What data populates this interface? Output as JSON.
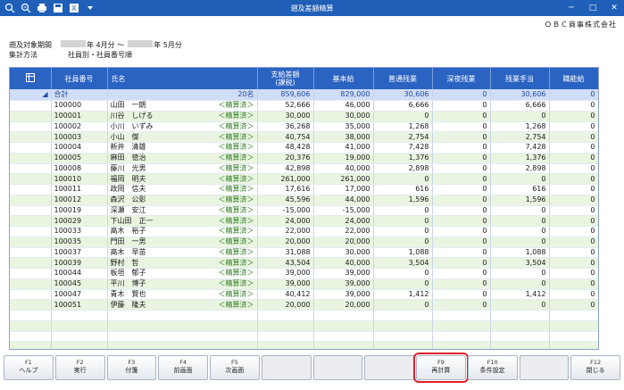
{
  "window": {
    "title": "遡及差額精算"
  },
  "toolbar_icons": [
    "add-icon",
    "search-icon",
    "print-icon",
    "save-icon",
    "excel-icon",
    "dropdown-icon"
  ],
  "company": "ＯＢＣ商事株式会社",
  "header": {
    "period_label": "遡及対象期間",
    "period_from": "年 4月分 ～",
    "period_to": "年 5月分",
    "method_label": "集計方法",
    "method_value": "社員別・社員番号順"
  },
  "columns": [
    "社員番号",
    "氏名",
    "支給差額\n(課税)",
    "基本給",
    "普通残業",
    "深夜残業",
    "残業手当",
    "職能給"
  ],
  "total": {
    "label": "合計",
    "count": "20名",
    "diff": "859,606",
    "base": "829,000",
    "ot": "30,606",
    "night": "0",
    "ot_allow": "30,606",
    "skill": "0"
  },
  "rows": [
    {
      "no": "100000",
      "name": "山田　一朗",
      "status": "＜精算済＞",
      "diff": "52,666",
      "base": "46,000",
      "ot": "6,666",
      "night": "0",
      "ot_allow": "6,666",
      "skill": "0"
    },
    {
      "no": "100001",
      "name": "川谷　しげる",
      "status": "＜精算済＞",
      "diff": "30,000",
      "base": "30,000",
      "ot": "0",
      "night": "0",
      "ot_allow": "0",
      "skill": "0"
    },
    {
      "no": "100002",
      "name": "小川　いずみ",
      "status": "＜精算済＞",
      "diff": "36,268",
      "base": "35,000",
      "ot": "1,268",
      "night": "0",
      "ot_allow": "1,268",
      "skill": "0"
    },
    {
      "no": "100003",
      "name": "小山　傑",
      "status": "＜精算済＞",
      "diff": "40,754",
      "base": "38,000",
      "ot": "2,754",
      "night": "0",
      "ot_allow": "2,754",
      "skill": "0"
    },
    {
      "no": "100004",
      "name": "新井　清雄",
      "status": "＜精算済＞",
      "diff": "48,428",
      "base": "41,000",
      "ot": "7,428",
      "night": "0",
      "ot_allow": "7,428",
      "skill": "0"
    },
    {
      "no": "100005",
      "name": "麻田　徳治",
      "status": "＜精算済＞",
      "diff": "20,376",
      "base": "19,000",
      "ot": "1,376",
      "night": "0",
      "ot_allow": "1,376",
      "skill": "0"
    },
    {
      "no": "100008",
      "name": "藤川　光男",
      "status": "＜精算済＞",
      "diff": "42,898",
      "base": "40,000",
      "ot": "2,898",
      "night": "0",
      "ot_allow": "2,898",
      "skill": "0"
    },
    {
      "no": "100010",
      "name": "福岡　明夫",
      "status": "＜精算済＞",
      "diff": "261,000",
      "base": "261,000",
      "ot": "0",
      "night": "0",
      "ot_allow": "0",
      "skill": "0"
    },
    {
      "no": "100011",
      "name": "政岡　信夫",
      "status": "＜精算済＞",
      "diff": "17,616",
      "base": "17,000",
      "ot": "616",
      "night": "0",
      "ot_allow": "616",
      "skill": "0"
    },
    {
      "no": "100012",
      "name": "森沢　公彰",
      "status": "＜精算済＞",
      "diff": "45,596",
      "base": "44,000",
      "ot": "1,596",
      "night": "0",
      "ot_allow": "1,596",
      "skill": "0"
    },
    {
      "no": "100019",
      "name": "深瀬　安江",
      "status": "＜精算済＞",
      "diff": "-15,000",
      "base": "-15,000",
      "ot": "0",
      "night": "0",
      "ot_allow": "0",
      "skill": "0"
    },
    {
      "no": "100029",
      "name": "下山田　正一",
      "status": "＜精算済＞",
      "diff": "24,000",
      "base": "24,000",
      "ot": "0",
      "night": "0",
      "ot_allow": "0",
      "skill": "0"
    },
    {
      "no": "100033",
      "name": "高木　裕子",
      "status": "＜精算済＞",
      "diff": "22,000",
      "base": "22,000",
      "ot": "0",
      "night": "0",
      "ot_allow": "0",
      "skill": "0"
    },
    {
      "no": "100035",
      "name": "門田　一男",
      "status": "＜精算済＞",
      "diff": "20,000",
      "base": "20,000",
      "ot": "0",
      "night": "0",
      "ot_allow": "0",
      "skill": "0"
    },
    {
      "no": "100037",
      "name": "高木　早苗",
      "status": "＜精算済＞",
      "diff": "31,088",
      "base": "30,000",
      "ot": "1,088",
      "night": "0",
      "ot_allow": "1,088",
      "skill": "0"
    },
    {
      "no": "100039",
      "name": "野村　哲",
      "status": "＜精算済＞",
      "diff": "43,504",
      "base": "40,000",
      "ot": "3,504",
      "night": "0",
      "ot_allow": "3,504",
      "skill": "0"
    },
    {
      "no": "100044",
      "name": "板垣　郁子",
      "status": "＜精算済＞",
      "diff": "39,000",
      "base": "39,000",
      "ot": "0",
      "night": "0",
      "ot_allow": "0",
      "skill": "0"
    },
    {
      "no": "100045",
      "name": "平川　博子",
      "status": "＜精算済＞",
      "diff": "39,000",
      "base": "39,000",
      "ot": "0",
      "night": "0",
      "ot_allow": "0",
      "skill": "0"
    },
    {
      "no": "100047",
      "name": "青木　賢也",
      "status": "＜精算済＞",
      "diff": "40,412",
      "base": "39,000",
      "ot": "1,412",
      "night": "0",
      "ot_allow": "1,412",
      "skill": "0"
    },
    {
      "no": "100051",
      "name": "伊藤　隆夫",
      "status": "＜精算済＞",
      "diff": "20,000",
      "base": "20,000",
      "ot": "0",
      "night": "0",
      "ot_allow": "0",
      "skill": "0"
    }
  ],
  "fkeys": [
    {
      "key": "F1",
      "label": "ヘルプ"
    },
    {
      "key": "F2",
      "label": "実行"
    },
    {
      "key": "F3",
      "label": "付箋"
    },
    {
      "key": "F4",
      "label": "前画面"
    },
    {
      "key": "F5",
      "label": "次画面"
    },
    {
      "key": "",
      "label": ""
    },
    {
      "key": "",
      "label": ""
    },
    {
      "key": "",
      "label": ""
    },
    {
      "key": "F9",
      "label": "再計算"
    },
    {
      "key": "F10",
      "label": "条件設定"
    },
    {
      "key": "",
      "label": ""
    },
    {
      "key": "F12",
      "label": "閉じる"
    }
  ]
}
